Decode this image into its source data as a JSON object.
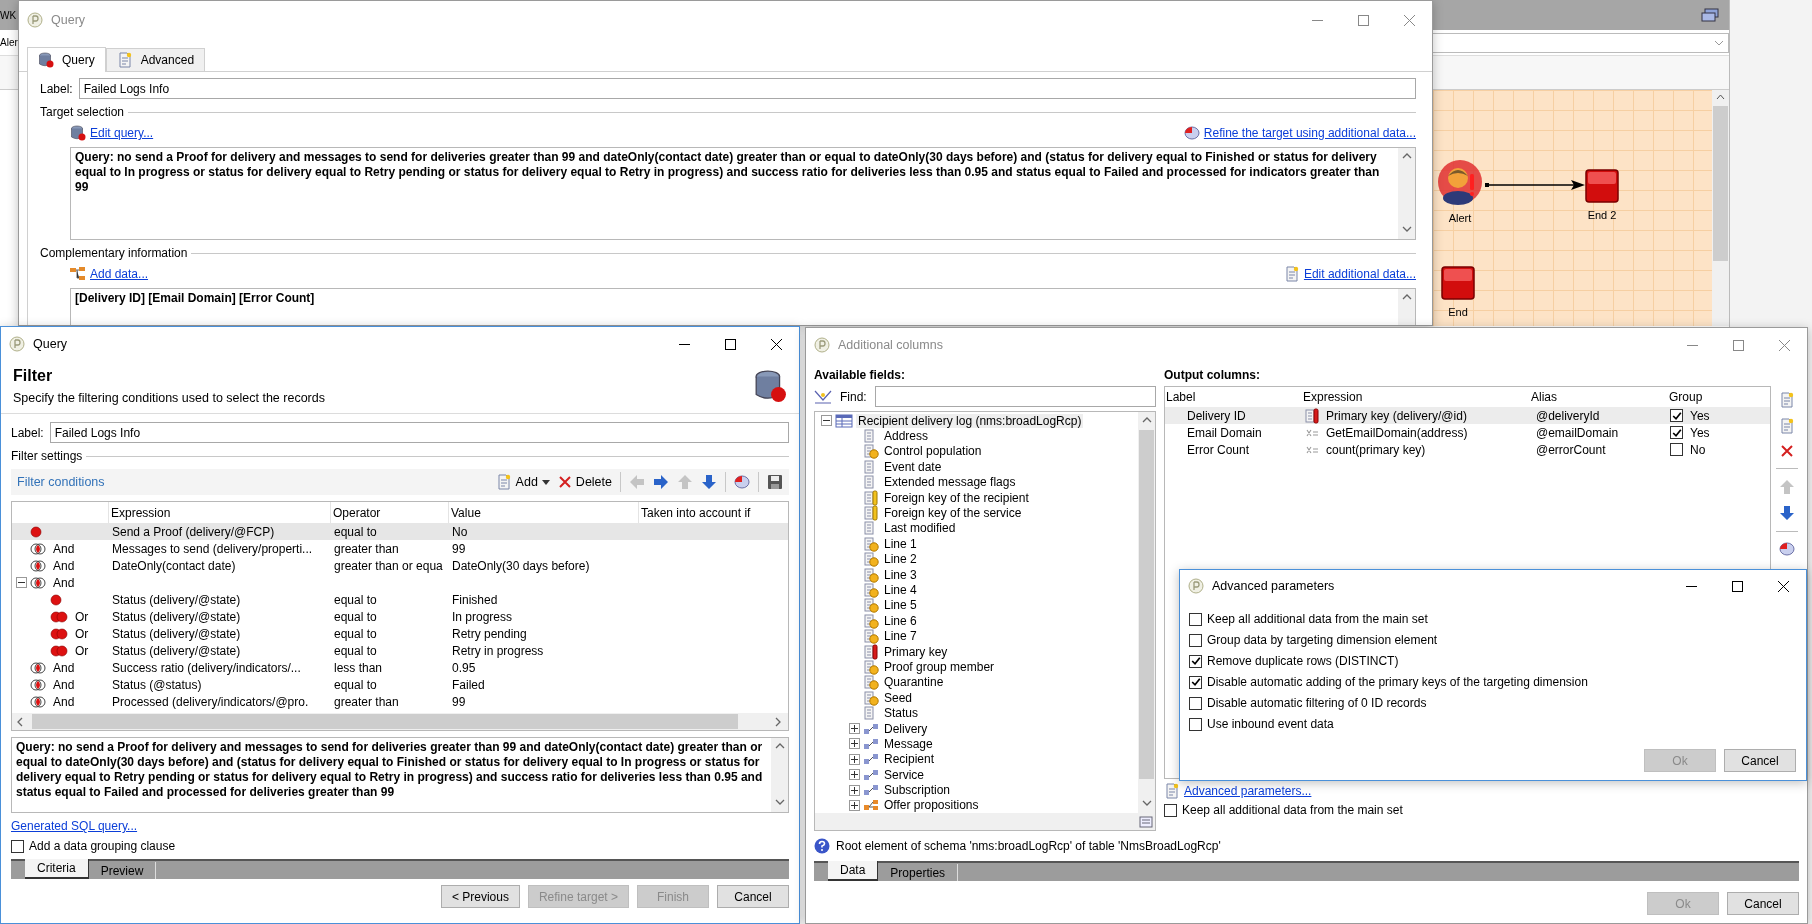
{
  "background_app": {
    "title": "WK",
    "toolbar_text": "Aler",
    "workflow": {
      "nodes": [
        {
          "label": "Alert",
          "kind": "alert"
        },
        {
          "label": "End 2",
          "kind": "end"
        },
        {
          "label": "End",
          "kind": "end"
        }
      ]
    }
  },
  "query_window": {
    "title": "Query",
    "active": false,
    "tabs": [
      {
        "label": "Query",
        "selected": true
      },
      {
        "label": "Advanced",
        "selected": false
      }
    ],
    "label_caption": "Label:",
    "label_value": "Failed Logs Info",
    "target_selection": {
      "heading": "Target selection",
      "edit_link": "Edit query...",
      "refine_link": "Refine the target using additional data...",
      "query_text": "Query: no send a Proof for delivery and messages to send for deliveries greater than 99 and dateOnly(contact date) greater than or equal to dateOnly(30 days before) and (status for delivery equal to Finished or status for delivery equal to In progress or status for delivery equal to Retry pending or status for delivery equal to Retry in progress) and success ratio for deliveries less than 0.95 and status equal to Failed and processed for indicators greater than 99"
    },
    "complementary": {
      "heading": "Complementary information",
      "add_link": "Add data...",
      "edit_link": "Edit additional data...",
      "columns_text": "[Delivery ID]  [Email Domain]  [Error Count]"
    }
  },
  "filter_window": {
    "title": "Query",
    "active": true,
    "heading": "Filter",
    "subtitle": "Specify the filtering conditions used to select the records",
    "label_caption": "Label:",
    "label_value": "Failed Logs Info",
    "settings_heading": "Filter settings",
    "conditions_title": "Filter conditions",
    "toolbar": {
      "add": "Add",
      "delete": "Delete"
    },
    "columns": [
      "Expression",
      "Operator",
      "Value",
      "Taken into account if"
    ],
    "rows": [
      {
        "kind": "first",
        "expression": "Send a Proof (delivery/@FCP)",
        "operator": "equal to",
        "value": "No",
        "selected": true
      },
      {
        "kind": "and",
        "conjunction": "And",
        "expression": "Messages to send (delivery/properti...",
        "operator": "greater than",
        "value": "99",
        "selected": false
      },
      {
        "kind": "and",
        "conjunction": "And",
        "expression": "DateOnly(contact date)",
        "operator": "greater than or equa",
        "value": "DateOnly(30 days before)",
        "selected": false
      },
      {
        "kind": "and",
        "conjunction": "And",
        "selected": false,
        "expanded": true,
        "children": [
          {
            "kind": "first",
            "expression": "Status (delivery/@state)",
            "operator": "equal to",
            "value": "Finished",
            "selected": false
          },
          {
            "kind": "or",
            "conjunction": "Or",
            "expression": "Status (delivery/@state)",
            "operator": "equal to",
            "value": "In progress",
            "selected": false
          },
          {
            "kind": "or",
            "conjunction": "Or",
            "expression": "Status (delivery/@state)",
            "operator": "equal to",
            "value": "Retry pending",
            "selected": false
          },
          {
            "kind": "or",
            "conjunction": "Or",
            "expression": "Status (delivery/@state)",
            "operator": "equal to",
            "value": "Retry in progress",
            "selected": false
          }
        ]
      },
      {
        "kind": "and",
        "conjunction": "And",
        "expression": "Success ratio (delivery/indicators/...",
        "operator": "less than",
        "value": "0.95",
        "selected": false
      },
      {
        "kind": "and",
        "conjunction": "And",
        "expression": "Status (@status)",
        "operator": "equal to",
        "value": "Failed",
        "selected": false
      },
      {
        "kind": "and",
        "conjunction": "And",
        "expression": "Processed (delivery/indicators/@pro.",
        "operator": "greater than",
        "value": "99",
        "selected": false
      }
    ],
    "query_text": "Query: no send a Proof for delivery and messages to send for deliveries greater than 99 and dateOnly(contact date) greater than or equal to dateOnly(30 days before) and (status for delivery equal to Finished or status for delivery equal to In progress or status for delivery equal to Retry pending or status for delivery equal to Retry in progress) and success ratio for deliveries less than 0.95 and status equal to Failed and processed for deliveries greater than 99",
    "sql_link": "Generated SQL query...",
    "grouping": {
      "label": "Add a data grouping clause",
      "checked": false
    },
    "tabs": [
      {
        "label": "Criteria",
        "selected": true
      },
      {
        "label": "Preview",
        "selected": false
      }
    ],
    "buttons": [
      {
        "label": "< Previous",
        "disabled": false
      },
      {
        "label": "Refine target >",
        "disabled": true
      },
      {
        "label": "Finish",
        "disabled": true
      },
      {
        "label": "Cancel",
        "disabled": false
      }
    ]
  },
  "additional_columns_window": {
    "title": "Additional columns",
    "active": false,
    "available_heading": "Available fields:",
    "find_label": "Find:",
    "tree": {
      "label": "Recipient delivery log (nms:broadLogRcp)",
      "selected": true,
      "expanded": true,
      "children": [
        {
          "label": "Address",
          "kind": "field",
          "selected": false
        },
        {
          "label": "Control population",
          "kind": "computed",
          "selected": false
        },
        {
          "label": "Event date",
          "kind": "field",
          "selected": false
        },
        {
          "label": "Extended message flags",
          "kind": "field",
          "selected": false
        },
        {
          "label": "Foreign key of the recipient",
          "kind": "foreign_key",
          "selected": false
        },
        {
          "label": "Foreign key of the service",
          "kind": "foreign_key",
          "selected": false
        },
        {
          "label": "Last modified",
          "kind": "field",
          "selected": false
        },
        {
          "label": "Line 1",
          "kind": "computed",
          "selected": false
        },
        {
          "label": "Line 2",
          "kind": "computed",
          "selected": false
        },
        {
          "label": "Line 3",
          "kind": "computed",
          "selected": false
        },
        {
          "label": "Line 4",
          "kind": "computed",
          "selected": false
        },
        {
          "label": "Line 5",
          "kind": "computed",
          "selected": false
        },
        {
          "label": "Line 6",
          "kind": "computed",
          "selected": false
        },
        {
          "label": "Line 7",
          "kind": "computed",
          "selected": false
        },
        {
          "label": "Primary key",
          "kind": "primary_key",
          "selected": false
        },
        {
          "label": "Proof group member",
          "kind": "computed",
          "selected": false
        },
        {
          "label": "Quarantine",
          "kind": "computed",
          "selected": false
        },
        {
          "label": "Seed",
          "kind": "computed",
          "selected": false
        },
        {
          "label": "Status",
          "kind": "field",
          "selected": false
        },
        {
          "label": "Delivery",
          "kind": "link",
          "expanded": false,
          "selected": false
        },
        {
          "label": "Message",
          "kind": "link",
          "expanded": false,
          "selected": false
        },
        {
          "label": "Recipient",
          "kind": "link",
          "expanded": false,
          "selected": false
        },
        {
          "label": "Service",
          "kind": "link",
          "expanded": false,
          "selected": false
        },
        {
          "label": "Subscription",
          "kind": "link",
          "expanded": false,
          "selected": false
        },
        {
          "label": "Offer propositions",
          "kind": "collection",
          "expanded": false,
          "selected": false
        }
      ]
    },
    "output_heading": "Output columns:",
    "output_columns": [
      "Label",
      "Expression",
      "Alias",
      "Group"
    ],
    "output_rows": [
      {
        "label": "Delivery ID",
        "expression": "Primary key (delivery/@id)",
        "kind": "primary_key",
        "alias": "@deliveryId",
        "group_checked": true,
        "group_text": "Yes",
        "selected": true
      },
      {
        "label": "Email Domain",
        "expression": "GetEmailDomain(address)",
        "kind": "formula",
        "alias": "@emailDomain",
        "group_checked": true,
        "group_text": "Yes",
        "selected": false
      },
      {
        "label": "Error Count",
        "expression": "count(primary key)",
        "kind": "formula",
        "alias": "@errorCount",
        "group_checked": false,
        "group_text": "No",
        "selected": false
      }
    ],
    "advanced_link": "Advanced parameters...",
    "keep_all": {
      "label": "Keep all additional data from the main set",
      "checked": false
    },
    "status_text": "Root element of schema 'nms:broadLogRcp' of table 'NmsBroadLogRcp'",
    "tabs": [
      {
        "label": "Data",
        "selected": true
      },
      {
        "label": "Properties",
        "selected": false
      }
    ],
    "buttons": [
      {
        "label": "Ok",
        "disabled": true
      },
      {
        "label": "Cancel",
        "disabled": false
      }
    ]
  },
  "advanced_parameters_dialog": {
    "title": "Advanced parameters",
    "active": true,
    "options": [
      {
        "label": "Keep all additional data from the main set",
        "checked": false
      },
      {
        "label": "Group data by targeting dimension element",
        "checked": false
      },
      {
        "label": "Remove duplicate rows (DISTINCT)",
        "checked": true
      },
      {
        "label": "Disable automatic adding of the primary keys of the targeting dimension",
        "checked": true
      },
      {
        "label": "Disable automatic filtering of 0 ID records",
        "checked": false
      },
      {
        "label": "Use inbound event data",
        "checked": false
      }
    ],
    "buttons": [
      {
        "label": "Ok",
        "disabled": true
      },
      {
        "label": "Cancel",
        "disabled": false
      }
    ]
  }
}
